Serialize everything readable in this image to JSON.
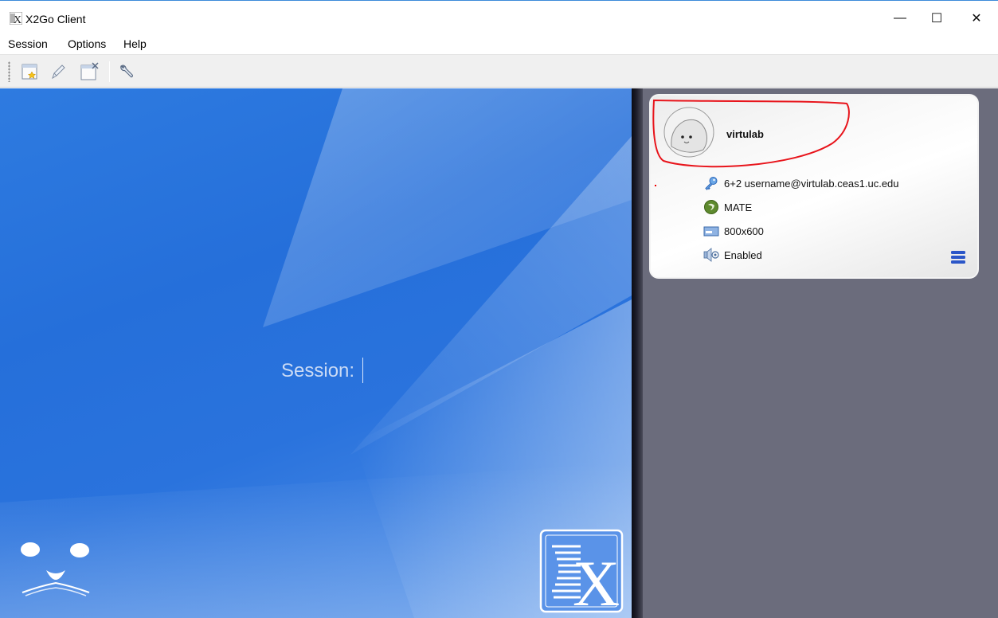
{
  "window": {
    "title": "X2Go Client",
    "controls": {
      "minimize": "—",
      "maximize": "☐",
      "close": "✕"
    }
  },
  "menu": {
    "items": [
      {
        "label": "Session"
      },
      {
        "label": "Options"
      },
      {
        "label": "Help"
      }
    ]
  },
  "toolbar": {
    "buttons": [
      {
        "icon": "new-session-icon"
      },
      {
        "icon": "edit-session-icon"
      },
      {
        "icon": "manage-sessions-icon"
      },
      {
        "icon": "preferences-wrench-icon"
      }
    ]
  },
  "login": {
    "session_label": "Session:"
  },
  "session_card": {
    "name": "virtulab",
    "server": "6+2 username@virtulab.ceas1.uc.edu",
    "desktop": "MATE",
    "resolution": "800x600",
    "sound": "Enabled",
    "highlight_color": "#e8141b"
  },
  "colors": {
    "left_pane": "#2a73dd",
    "right_pane": "#6b6c7c",
    "menu_icon": "#2b56c8"
  }
}
